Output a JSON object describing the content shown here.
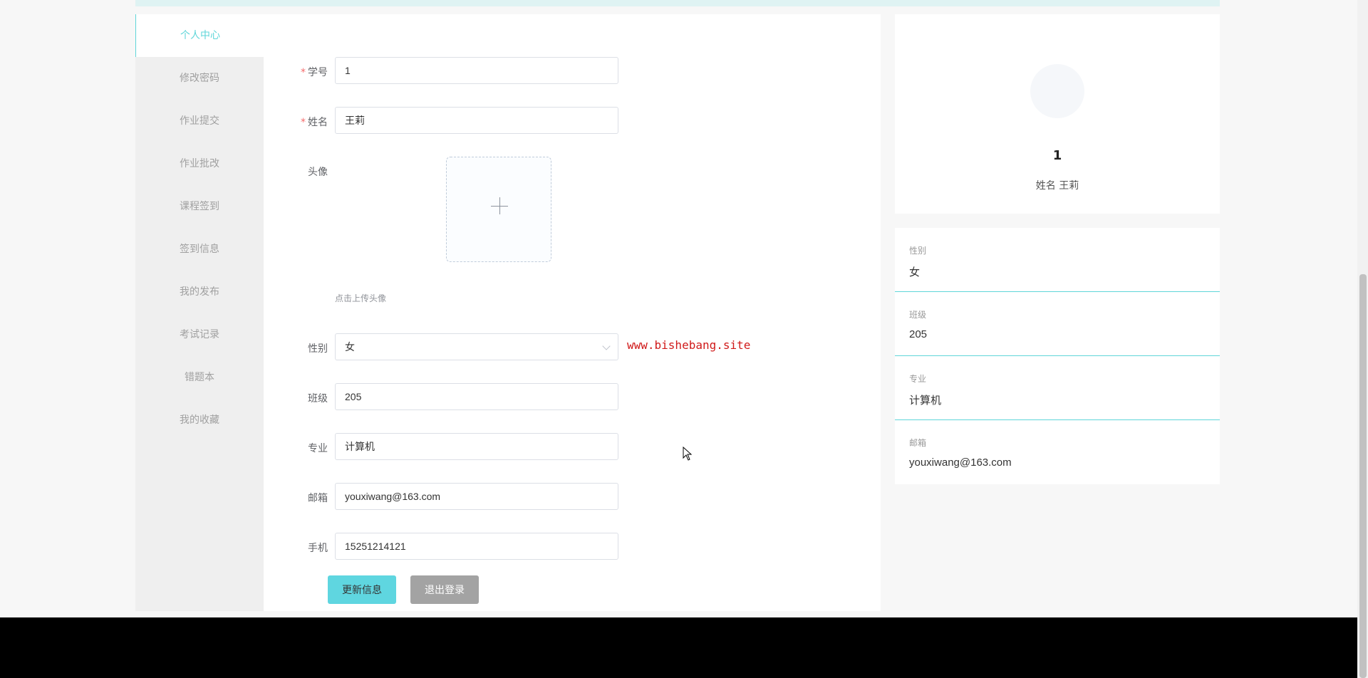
{
  "sidebar": {
    "items": [
      {
        "label": "个人中心",
        "active": true
      },
      {
        "label": "修改密码"
      },
      {
        "label": "作业提交"
      },
      {
        "label": "作业批改"
      },
      {
        "label": "课程签到"
      },
      {
        "label": "签到信息"
      },
      {
        "label": "我的发布"
      },
      {
        "label": "考试记录"
      },
      {
        "label": "错题本"
      },
      {
        "label": "我的收藏"
      }
    ]
  },
  "form": {
    "student_id": {
      "label": "学号",
      "required_mark": "*",
      "value": "1"
    },
    "name": {
      "label": "姓名",
      "required_mark": "*",
      "value": "王莉"
    },
    "avatar": {
      "label": "头像",
      "tip": "点击上传头像"
    },
    "gender": {
      "label": "性别",
      "value": "女"
    },
    "class": {
      "label": "班级",
      "value": "205"
    },
    "major": {
      "label": "专业",
      "value": "计算机"
    },
    "email": {
      "label": "邮箱",
      "value": "youxiwang@163.com"
    },
    "phone": {
      "label": "手机",
      "value": "15251214121"
    },
    "update_button": "更新信息",
    "logout_button": "退出登录"
  },
  "watermark": "www.bishebang.site",
  "profile": {
    "id": "1",
    "name_line": "姓名 王莉"
  },
  "info": [
    {
      "label": "性别",
      "value": "女"
    },
    {
      "label": "班级",
      "value": "205"
    },
    {
      "label": "专业",
      "value": "计算机"
    },
    {
      "label": "邮箱",
      "value": "youxiwang@163.com"
    }
  ],
  "colors": {
    "accent": "#5fd6d9",
    "primary_button": "#5fd6e0",
    "gray_button": "#a3a3a3",
    "required": "#f56c6c",
    "watermark": "#d01a1a"
  },
  "icons": {
    "upload": "plus-icon",
    "select": "chevron-down-icon",
    "cursor": "mouse-pointer-icon"
  }
}
